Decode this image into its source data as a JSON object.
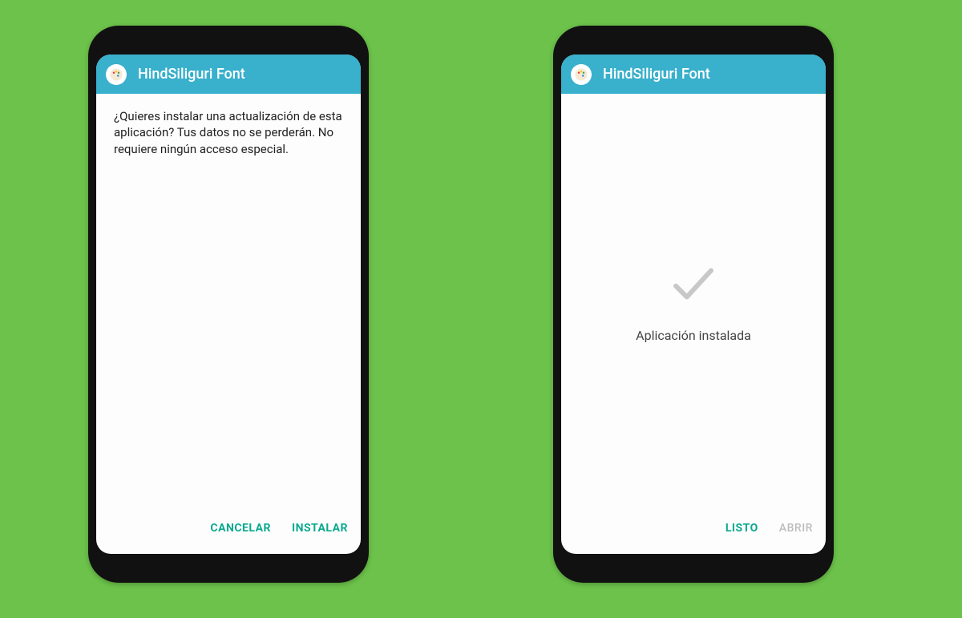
{
  "colors": {
    "background": "#6cc24a",
    "appbar": "#39b0cc",
    "accent": "#0aa98f",
    "disabled": "#bdbdbd"
  },
  "left": {
    "title": "HindSiliguri Font",
    "message": "¿Quieres instalar una actualización de esta aplicación? Tus datos no se perderán. No requiere ningún acceso especial.",
    "cancel": "CANCELAR",
    "install": "INSTALAR"
  },
  "right": {
    "title": "HindSiliguri Font",
    "installed": "Aplicación instalada",
    "done": "LISTO",
    "open": "ABRIR"
  }
}
